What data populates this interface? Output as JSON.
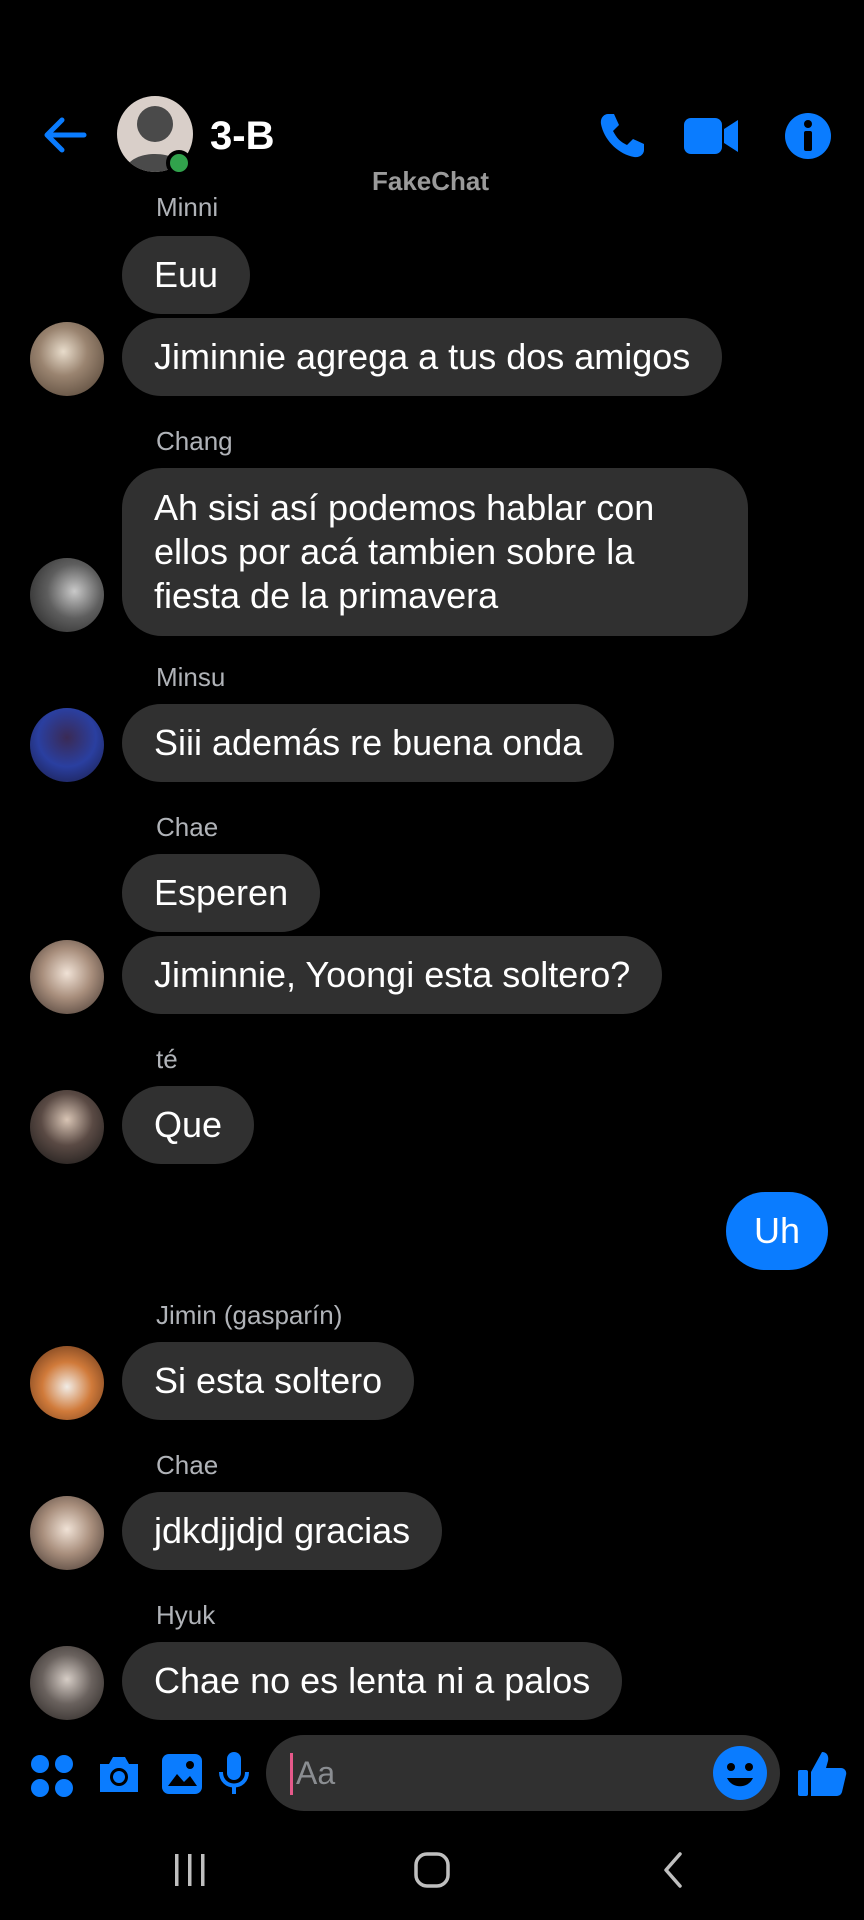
{
  "header": {
    "group_name": "3-B",
    "watermark": "FakeChat"
  },
  "messages": [
    {
      "sender": "Minni",
      "bubbles": [
        "Euu",
        "Jiminnie agrega a tus dos amigos"
      ]
    },
    {
      "sender": "Chang",
      "bubbles": [
        "Ah sisi así podemos hablar con ellos por acá tambien sobre la fiesta de la primavera"
      ]
    },
    {
      "sender": "Minsu",
      "bubbles": [
        "Siii además re buena onda"
      ]
    },
    {
      "sender": "Chae",
      "bubbles": [
        "Esperen",
        "Jiminnie, Yoongi esta soltero?"
      ]
    },
    {
      "sender": "té",
      "bubbles": [
        "Que"
      ]
    },
    {
      "sender": "",
      "mine": true,
      "bubbles": [
        "Uh"
      ]
    },
    {
      "sender": "Jimin (gasparín)",
      "bubbles": [
        "Si esta soltero"
      ]
    },
    {
      "sender": "Chae",
      "bubbles": [
        "jdkdjjdjd gracias"
      ]
    },
    {
      "sender": "Hyuk",
      "bubbles": [
        "Chae no es lenta ni a palos"
      ]
    }
  ],
  "composer": {
    "placeholder": "Aa"
  },
  "colors": {
    "accent": "#0a7cff",
    "bubble_incoming": "#303030",
    "online": "#31a24c",
    "background": "#000000"
  },
  "icons": {
    "header": [
      "back-arrow-icon",
      "phone-icon",
      "video-camera-icon",
      "info-icon"
    ],
    "composer": [
      "apps-icon",
      "camera-icon",
      "gallery-icon",
      "microphone-icon",
      "emoji-icon",
      "thumbs-up-icon"
    ],
    "navigation": [
      "recent-apps-icon",
      "home-icon",
      "back-icon"
    ]
  }
}
